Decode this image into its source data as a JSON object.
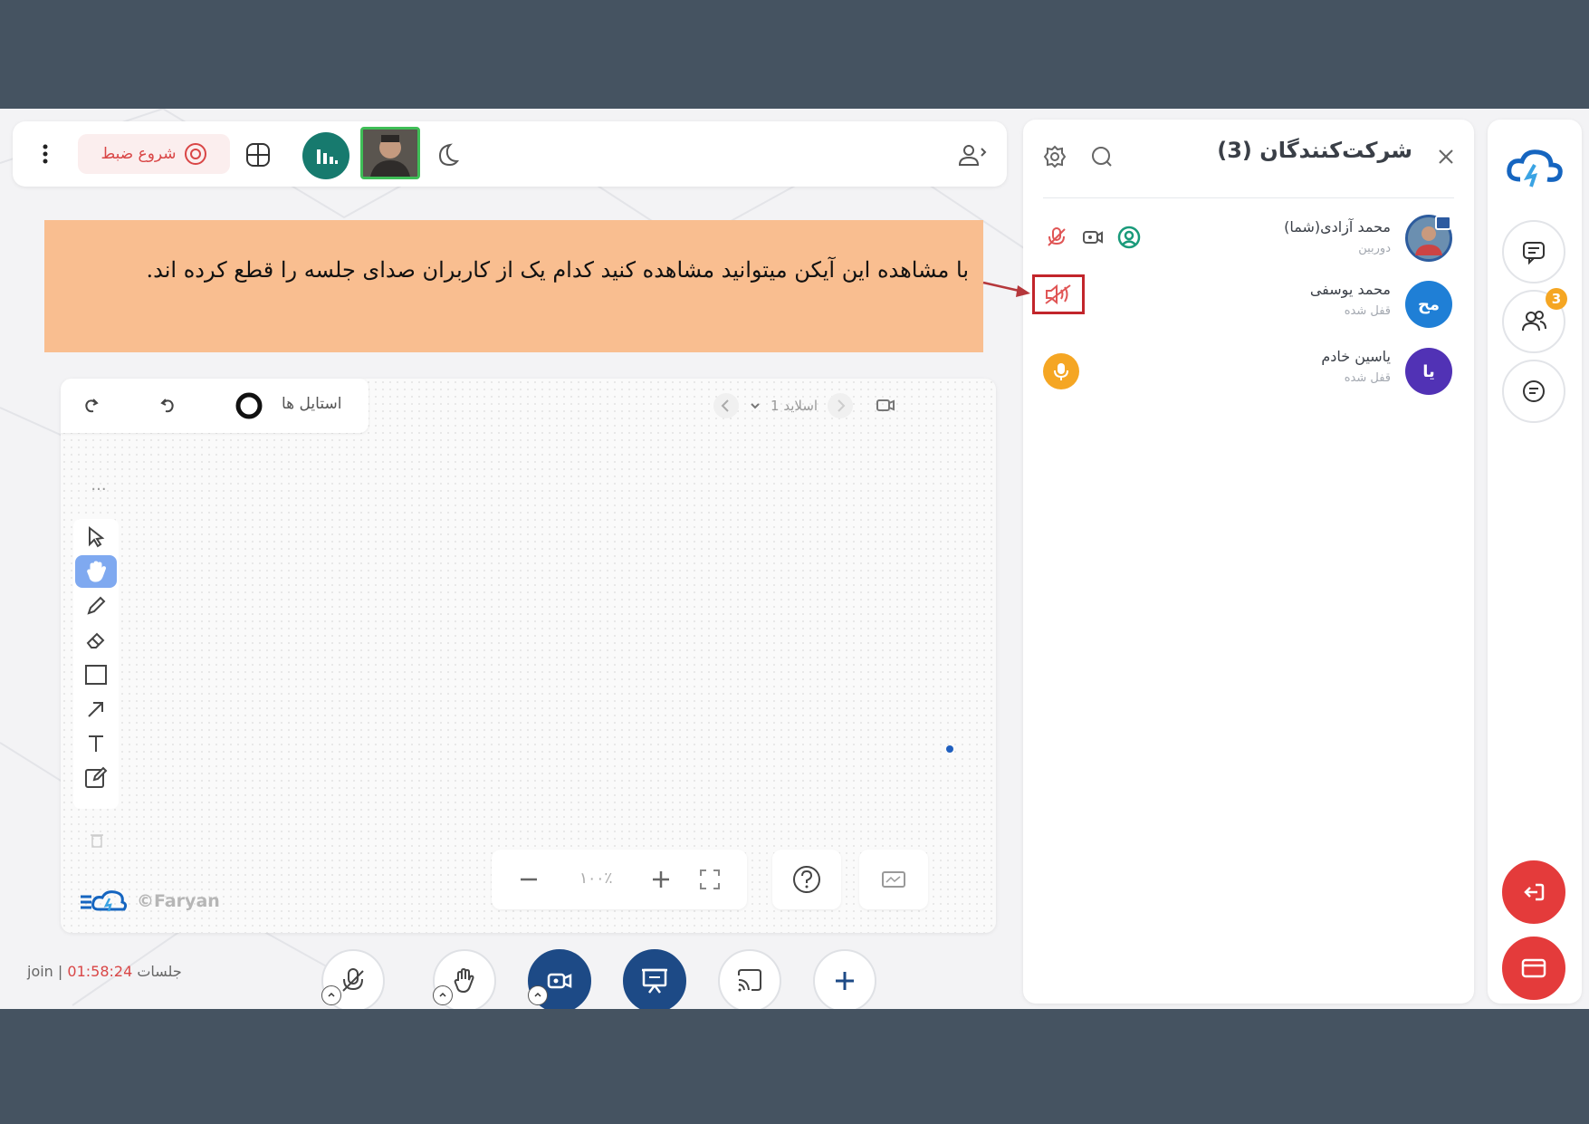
{
  "topbar": {
    "record_label": "شروع ضبط",
    "more_icon": "vertical-dots-icon",
    "record_icon": "record-icon",
    "layout_icon": "layout-grid-icon",
    "stats_icon": "stats-bars-icon",
    "theme_icon": "moon-icon",
    "participants_toggle_icon": "person-arrow-icon"
  },
  "annotation": {
    "text": "با مشاهده این آیکن میتوانید مشاهده کنید کدام یک از کاربران صدای جلسه را قطع کرده اند."
  },
  "panel": {
    "title": "شرکت‌کنندگان (3)",
    "participants": [
      {
        "name": "محمد آزادی(شما)",
        "status": "دوربین",
        "initials": "",
        "avatar_color": "#4a6d8c",
        "icons": [
          "mic-off-icon",
          "camera-icon",
          "user-circle-icon"
        ]
      },
      {
        "name": "محمد یوسفی",
        "status": "قفل شده",
        "initials": "مح",
        "avatar_color": "#1f7fd6",
        "icons": [
          "speaker-off-icon"
        ]
      },
      {
        "name": "یاسین خادم",
        "status": "قفل شده",
        "initials": "یا",
        "avatar_color": "#5132b5",
        "icons": [
          "mic-active-icon"
        ]
      }
    ]
  },
  "rail": {
    "participants_badge": "3"
  },
  "board": {
    "styles_label": "استایل ها",
    "slide_label": "اسلاید 1",
    "zoom": "۱۰۰٪",
    "brand": "©Faryan"
  },
  "footer": {
    "session_label": "جلسات",
    "session_time": "01:58:24",
    "session_sep": " | ",
    "session_status": "join"
  },
  "colors": {
    "accent": "#1d4a86",
    "danger": "#e43b3b",
    "note_bg": "#f9be90",
    "teal": "#177a6e"
  }
}
